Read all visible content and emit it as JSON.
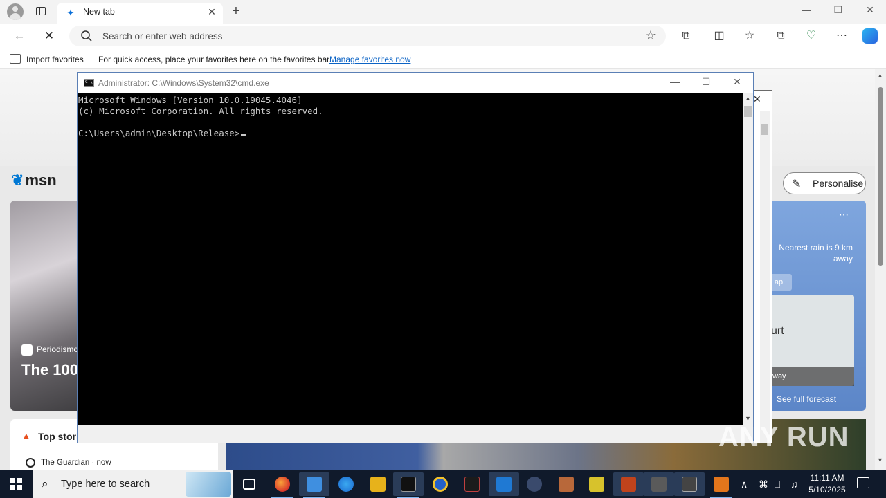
{
  "browser": {
    "tab_title": "New tab",
    "address_placeholder": "Search or enter web address",
    "favorites_bar": {
      "import_label": "Import favorites",
      "hint": "For quick access, place your favorites here on the favorites bar.",
      "manage_link": "Manage favorites now"
    }
  },
  "msn": {
    "logo": "msn",
    "personalise_label": "Personalise",
    "hero": {
      "source": "Periodismo",
      "headline": "The 100"
    },
    "weather": {
      "rain_text": "Nearest rain is 9 km away",
      "map_label": "ap",
      "place": "urt",
      "way_label": "way",
      "forecast_link": "See full forecast"
    },
    "top_stories": {
      "title": "Top stories",
      "item": "The Guardian · now"
    }
  },
  "cmd": {
    "title": "Administrator: C:\\Windows\\System32\\cmd.exe",
    "lines": [
      "Microsoft Windows [Version 10.0.19045.4046]",
      "(c) Microsoft Corporation. All rights reserved.",
      "",
      "C:\\Users\\admin\\Desktop\\Release>"
    ]
  },
  "watermark": "ANY RUN",
  "taskbar": {
    "search_placeholder": "Type here to search",
    "clock_time": "11:11 AM",
    "clock_date": "5/10/2025"
  },
  "colors": {
    "taskbar_bg": "#101a2b",
    "console_bg": "#000000",
    "console_text": "#c8c8c8",
    "link": "#0b63c5"
  },
  "icons": [
    "profile-icon",
    "tab-actions-icon",
    "edge-favicon",
    "back-icon",
    "refresh-stop-icon",
    "search-icon",
    "favorite-star-icon",
    "extensions-icon",
    "split-screen-icon",
    "favorites-icon",
    "collections-icon",
    "browser-essentials-icon",
    "more-icon",
    "copilot-icon",
    "windows-start-icon",
    "task-view-icon",
    "notification-icon"
  ]
}
